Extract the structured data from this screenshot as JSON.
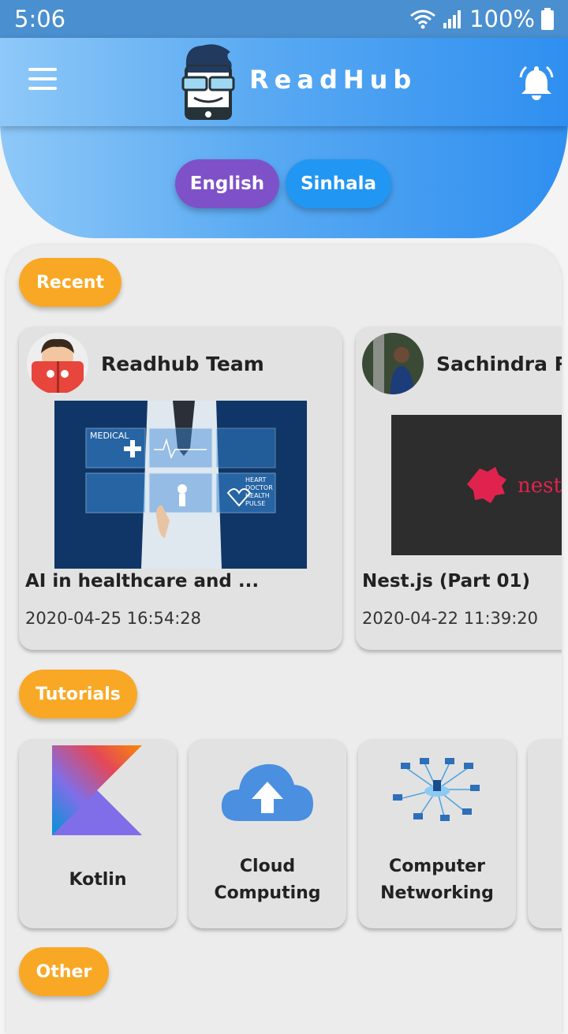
{
  "status": {
    "time": "5:06",
    "battery": "100%"
  },
  "app": {
    "title": "ReadHub"
  },
  "languages": [
    "English",
    "Sinhala"
  ],
  "sections": {
    "recent": "Recent",
    "tutorials": "Tutorials",
    "other": "Other"
  },
  "recent": [
    {
      "author": "Readhub Team",
      "title": "AI in healthcare and ...",
      "date": "2020-04-25 16:54:28",
      "image_text": [
        "MEDICAL",
        "HEART",
        "DOCTOR",
        "HEALTH",
        "PULSE"
      ]
    },
    {
      "author": "Sachindra R",
      "title": "Nest.js (Part 01)",
      "date": "2020-04-22 11:39:20",
      "image_text": [
        "nest"
      ]
    }
  ],
  "tutorials": [
    {
      "line1": "Kotlin",
      "line2": "",
      "icon": "kotlin-logo-icon"
    },
    {
      "line1": "Cloud",
      "line2": "Computing",
      "icon": "cloud-upload-icon"
    },
    {
      "line1": "Computer",
      "line2": "Networking",
      "icon": "network-icon"
    }
  ],
  "colors": {
    "accent": "#2196f3",
    "english": "#7e51c9",
    "chip": "#f9a825"
  }
}
